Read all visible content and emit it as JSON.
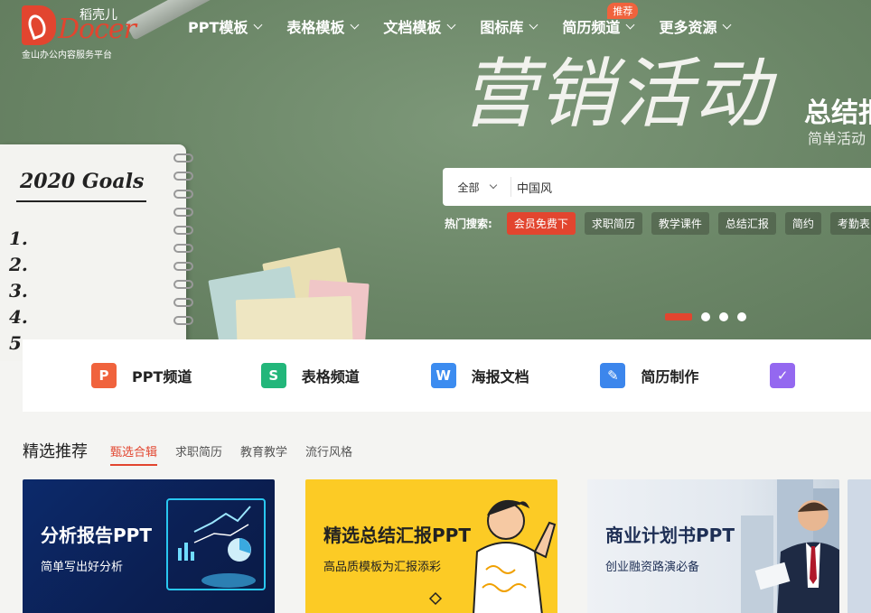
{
  "logo": {
    "cn_name": "稻壳儿",
    "wordmark": "Docer",
    "subtitle": "金山办公内容服务平台"
  },
  "nav": {
    "items": [
      {
        "label": "PPT模板",
        "badge": ""
      },
      {
        "label": "表格模板",
        "badge": ""
      },
      {
        "label": "文档模板",
        "badge": ""
      },
      {
        "label": "图标库",
        "badge": ""
      },
      {
        "label": "简历频道",
        "badge": "推荐"
      },
      {
        "label": "更多资源",
        "badge": ""
      }
    ]
  },
  "banner": {
    "headline": "营销活动",
    "headline_right": "总结报",
    "headline_right_sub": "简单活动",
    "notebook_title": "2020 Goals",
    "notebook_items": [
      "1.",
      "2.",
      "3.",
      "4.",
      "5."
    ]
  },
  "search": {
    "category": "全部",
    "value": "中国风"
  },
  "hot_search": {
    "label": "热门搜索:",
    "tags": [
      "会员免费下",
      "求职简历",
      "教学课件",
      "总结汇报",
      "简约",
      "考勤表"
    ]
  },
  "channels": [
    {
      "label": "PPT频道",
      "icon": "ppt-icon",
      "glyph": "P",
      "color": "#f0633d"
    },
    {
      "label": "表格频道",
      "icon": "sheet-icon",
      "glyph": "S",
      "color": "#22b67a"
    },
    {
      "label": "海报文档",
      "icon": "word-icon",
      "glyph": "W",
      "color": "#3c8cf0"
    },
    {
      "label": "简历制作",
      "icon": "resume-icon",
      "glyph": "✎",
      "color": "#3c86ec"
    },
    {
      "label": "",
      "icon": "clipboard-icon",
      "glyph": "✓",
      "color": "#9468f0"
    }
  ],
  "section": {
    "title": "精选推荐",
    "tabs": [
      "甄选合辑",
      "求职简历",
      "教育教学",
      "流行风格"
    ]
  },
  "cards": [
    {
      "title": "分析报告PPT",
      "subtitle": "简单写出好分析"
    },
    {
      "title": "精选总结汇报PPT",
      "subtitle": "高品质模板为汇报添彩"
    },
    {
      "title": "商业计划书PPT",
      "subtitle": "创业融资路演必备"
    }
  ]
}
